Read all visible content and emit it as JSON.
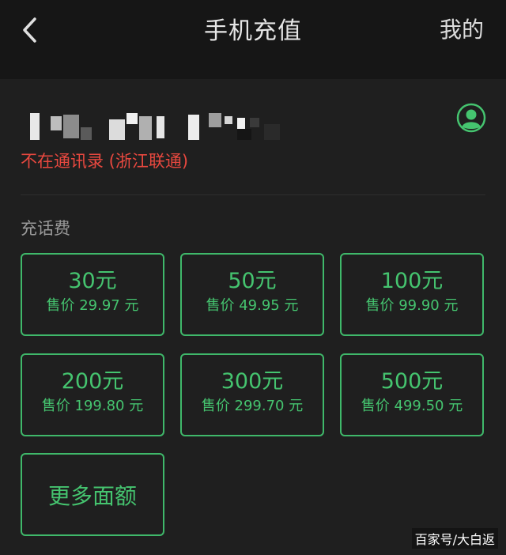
{
  "header": {
    "title": "手机充值",
    "mine_label": "我的",
    "back_icon": "chevron-left-icon"
  },
  "account": {
    "phone_number_masked": "pixelated",
    "contact_note": "不在通讯录 (浙江联通)",
    "contact_icon": "person-circle-icon"
  },
  "section": {
    "label": "充话费"
  },
  "options": [
    {
      "amount": "30元",
      "price": "售价 29.97 元"
    },
    {
      "amount": "50元",
      "price": "售价 49.95 元"
    },
    {
      "amount": "100元",
      "price": "售价 99.90 元"
    },
    {
      "amount": "200元",
      "price": "售价 199.80 元"
    },
    {
      "amount": "300元",
      "price": "售价 299.70 元"
    },
    {
      "amount": "500元",
      "price": "售价 499.50 元"
    }
  ],
  "more": {
    "label": "更多面额"
  },
  "watermark": "百家号/大白返",
  "colors": {
    "background": "#1f1f1f",
    "topbar": "#161616",
    "accent_green": "#45c46f",
    "warning_red": "#e8483f"
  }
}
